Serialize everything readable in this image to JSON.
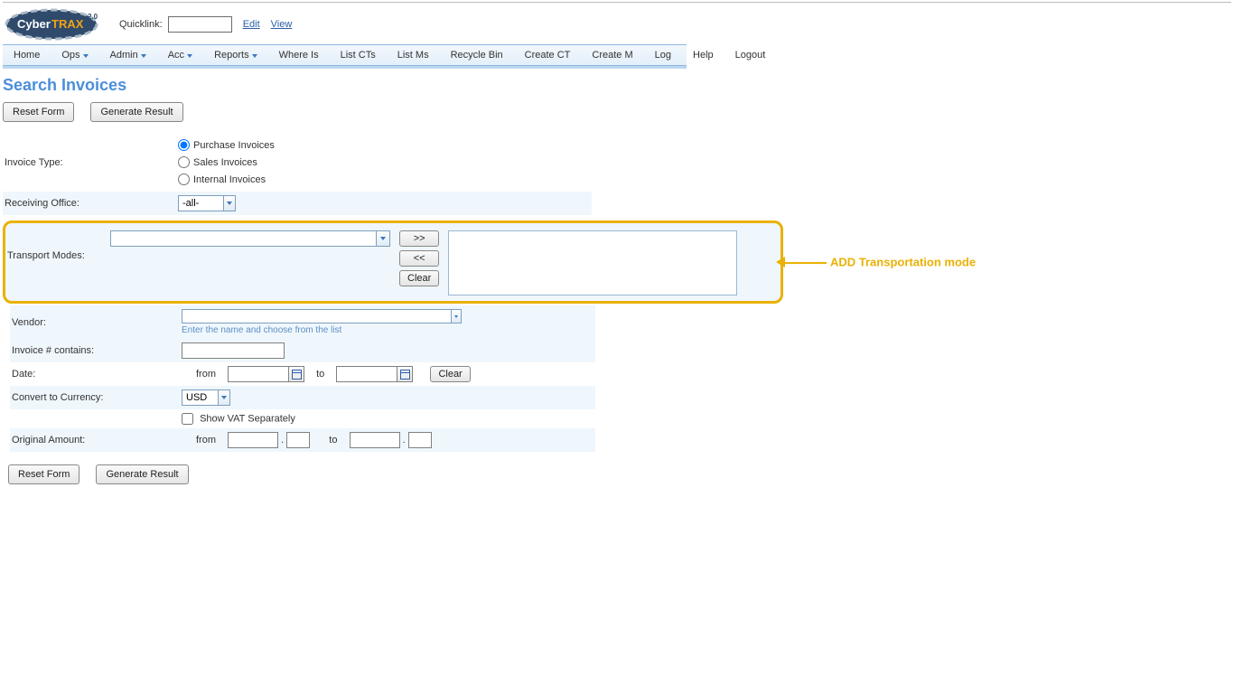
{
  "header": {
    "logo_brand_a": "Cyber",
    "logo_brand_b": "TRAX",
    "logo_ver": "2.0",
    "quicklink_label": "Quicklink:",
    "edit": "Edit",
    "view": "View"
  },
  "nav": {
    "home": "Home",
    "ops": "Ops",
    "admin": "Admin",
    "acc": "Acc",
    "reports": "Reports",
    "where": "Where Is",
    "listcts": "List CTs",
    "listms": "List Ms",
    "recycle": "Recycle Bin",
    "createct": "Create CT",
    "createm": "Create M",
    "log": "Log",
    "help": "Help",
    "logout": "Logout"
  },
  "page": {
    "title": "Search Invoices",
    "reset": "Reset Form",
    "generate": "Generate Result"
  },
  "form": {
    "invoice_type_label": "Invoice Type:",
    "purchase": "Purchase Invoices",
    "sales": "Sales Invoices",
    "internal": "Internal Invoices",
    "receiving_office_label": "Receiving Office:",
    "receiving_office_value": "-all-",
    "transport_modes_label": "Transport Modes:",
    "tm_add": ">>",
    "tm_remove": "<<",
    "tm_clear": "Clear",
    "tm_annotation": "ADD Transportation mode",
    "vendor_label": "Vendor:",
    "vendor_hint": "Enter the name and choose from the list",
    "invoice_contains_label": "Invoice # contains:",
    "date_label": "Date:",
    "date_from": "from",
    "date_to": "to",
    "date_clear": "Clear",
    "currency_label": "Convert to Currency:",
    "currency_value": "USD",
    "vat_label": "Show VAT Separately",
    "amount_label": "Original Amount:",
    "amount_from": "from",
    "amount_to": "to"
  }
}
